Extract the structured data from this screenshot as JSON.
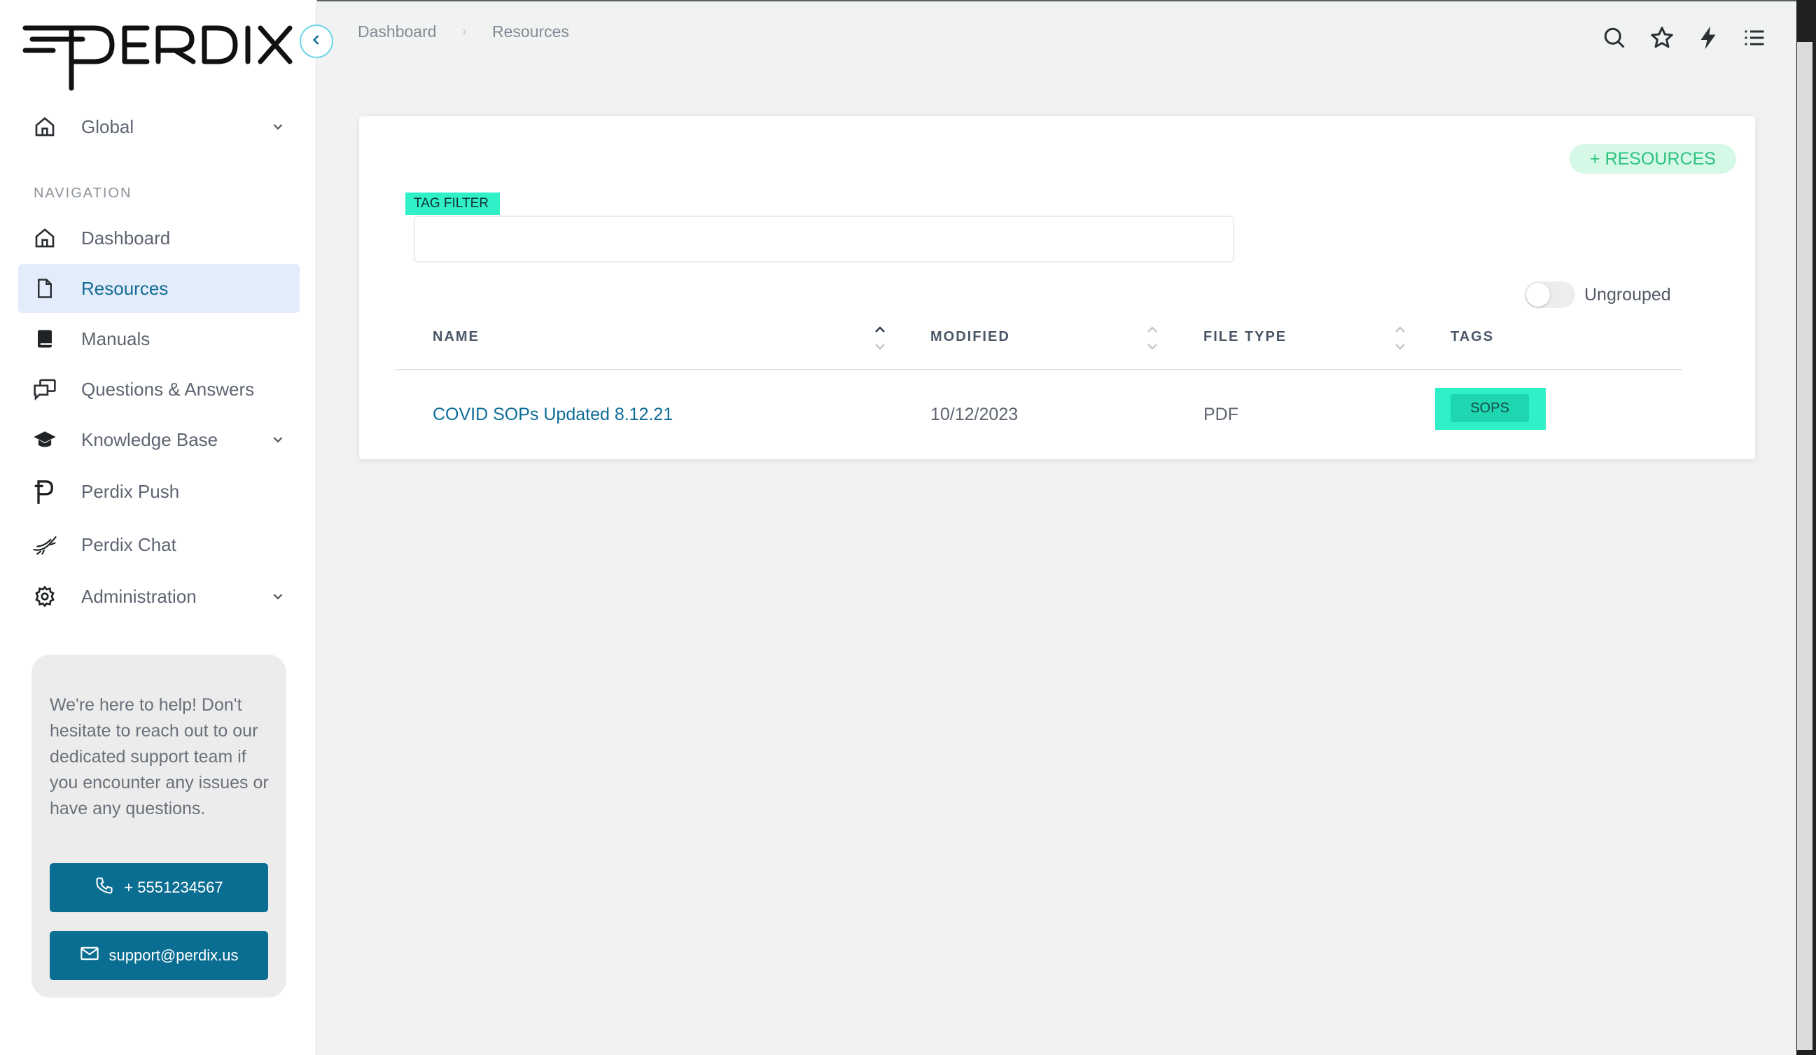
{
  "brand": {
    "logo_text": "PERDIX"
  },
  "sidebar": {
    "workspace": {
      "label": "Global"
    },
    "section_title": "NAVIGATION",
    "items": [
      {
        "label": "Dashboard",
        "icon": "home-icon"
      },
      {
        "label": "Resources",
        "icon": "file-icon",
        "active": true
      },
      {
        "label": "Manuals",
        "icon": "book-icon"
      },
      {
        "label": "Questions & Answers",
        "icon": "chat-bubbles-icon"
      },
      {
        "label": "Knowledge Base",
        "icon": "graduation-cap-icon",
        "expandable": true
      },
      {
        "label": "Perdix Push",
        "icon": "perdix-p-icon"
      },
      {
        "label": "Perdix Chat",
        "icon": "bird-icon"
      },
      {
        "label": "Administration",
        "icon": "gear-icon",
        "expandable": true
      }
    ],
    "help": {
      "text": "We're here to help! Don't hesitate to reach out to our dedicated support team if you encounter any issues or have any questions.",
      "phone": "+ 5551234567",
      "email": "support@perdix.us"
    }
  },
  "breadcrumb": {
    "root": "Dashboard",
    "current": "Resources"
  },
  "topbar_icons": [
    "search-icon",
    "star-icon",
    "lightning-icon",
    "list-icon"
  ],
  "resources": {
    "add_button": "+ RESOURCES",
    "tag_filter": {
      "label": "TAG FILTER",
      "value": ""
    },
    "grouping_toggle": {
      "label": "Ungrouped",
      "on": false
    },
    "columns": [
      "NAME",
      "MODIFIED",
      "FILE TYPE",
      "TAGS"
    ],
    "rows": [
      {
        "name": "COVID SOPs Updated 8.12.21",
        "modified": "10/12/2023",
        "file_type": "PDF",
        "tags": [
          "SOPS"
        ]
      }
    ]
  },
  "colors": {
    "primary": "#0a6d92",
    "link": "#0e6c97",
    "highlight": "#2ff0c6",
    "active_nav_bg": "#e3ecfb",
    "add_button_bg": "#d6f8e7",
    "add_button_text": "#2bc37d"
  }
}
